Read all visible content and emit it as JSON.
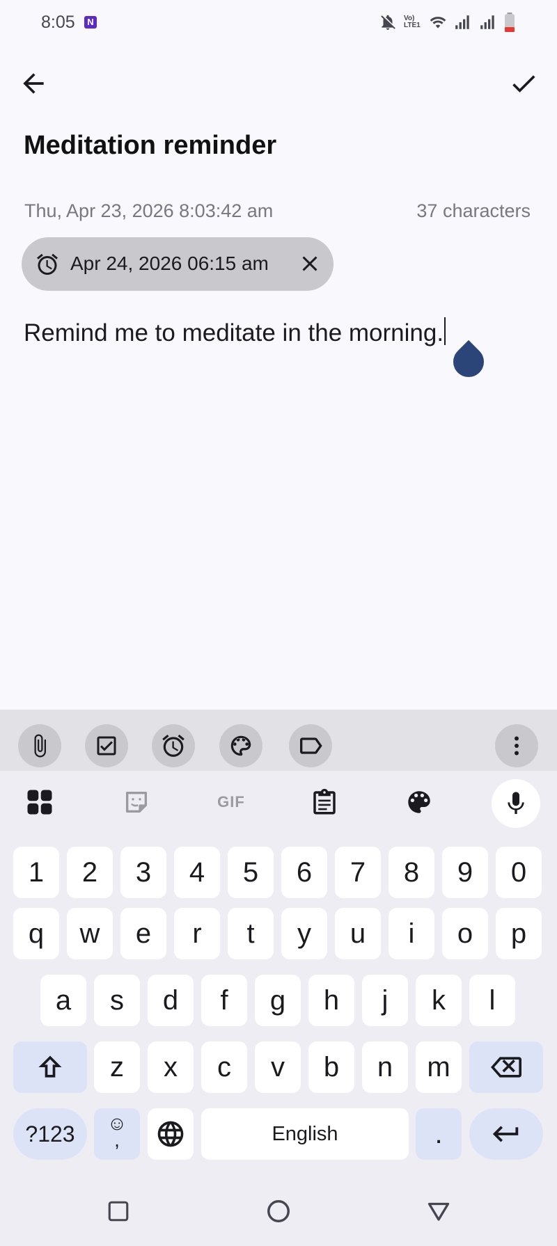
{
  "status_bar": {
    "time": "8:05",
    "app_icon_letter": "N",
    "network_label": "Vo) LTE1"
  },
  "app_bar": {
    "back_icon": "arrow-left-icon",
    "save_icon": "check-icon"
  },
  "note": {
    "title": "Meditation reminder",
    "date": "Thu, Apr 23, 2026 8:03:42 am",
    "char_count": "37 characters",
    "body": "Remind me to meditate in the morning."
  },
  "reminder_chip": {
    "text": "Apr 24, 2026 06:15 am"
  },
  "format_toolbar": {
    "buttons": [
      "paperclip-icon",
      "checkbox-icon",
      "alarm-icon",
      "palette-icon",
      "label-icon",
      "more-vert-icon"
    ]
  },
  "keyboard": {
    "suggestion_bar": {
      "gif_label": "GIF"
    },
    "rows": {
      "numbers": [
        "1",
        "2",
        "3",
        "4",
        "5",
        "6",
        "7",
        "8",
        "9",
        "0"
      ],
      "row1": [
        "q",
        "w",
        "e",
        "r",
        "t",
        "y",
        "u",
        "i",
        "o",
        "p"
      ],
      "row2": [
        "a",
        "s",
        "d",
        "f",
        "g",
        "h",
        "j",
        "k",
        "l"
      ],
      "row3": [
        "z",
        "x",
        "c",
        "v",
        "b",
        "n",
        "m"
      ]
    },
    "symbols_label": "?123",
    "emoji_label": "☺",
    "comma_label": ",",
    "space_label": "English",
    "period_label": "."
  },
  "colors": {
    "accent": "#2c4578",
    "chip": "#c9c8cd",
    "background": "#f9f8fd",
    "keyboard": "#eeedf3"
  }
}
